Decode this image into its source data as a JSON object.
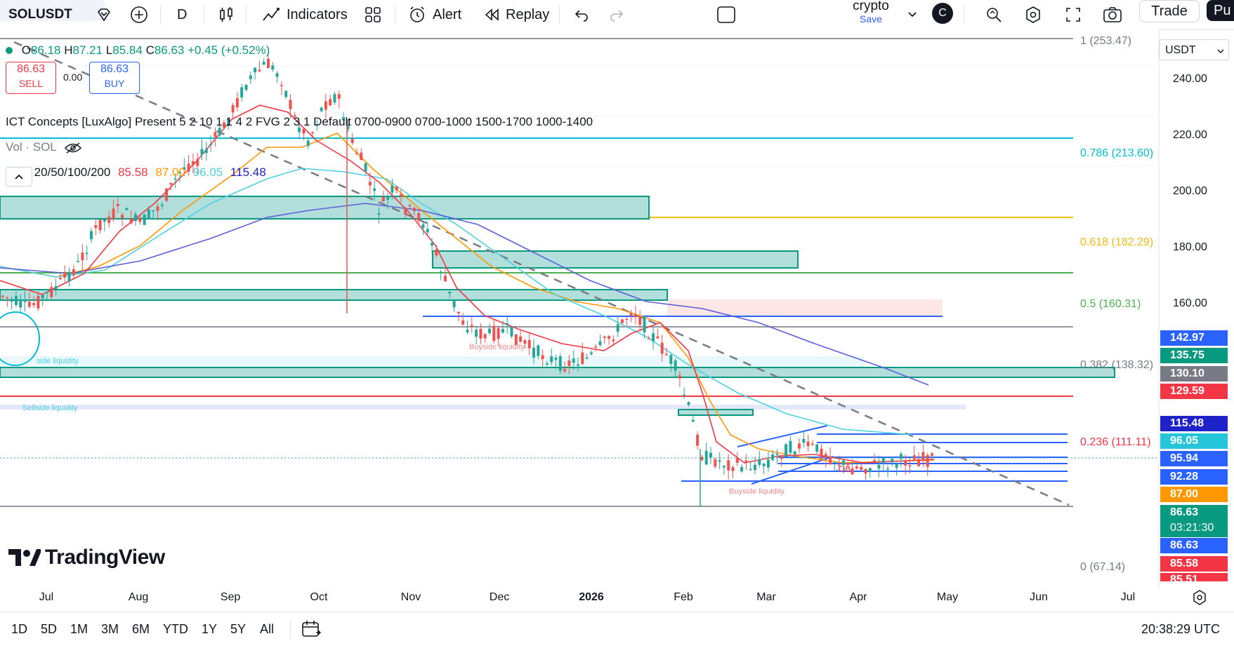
{
  "toolbar": {
    "symbol": "SOLUSDT",
    "interval": "D",
    "indicators_label": "Indicators",
    "alert_label": "Alert",
    "replay_label": "Replay",
    "layout_name": "crypto",
    "save_label": "Save",
    "avatar_letter": "C",
    "trade_label": "Trade",
    "publish_label": "Pu"
  },
  "legend": {
    "ohlc": {
      "o_label": "O",
      "o": "86.18",
      "h_label": "H",
      "h": "87.21",
      "l_label": "L",
      "l": "85.84",
      "c_label": "C",
      "c": "86.63",
      "change": "+0.45 (+0.52%)"
    },
    "sell_price": "86.63",
    "sell_label": "SELL",
    "spread": "0.00",
    "buy_price": "86.63",
    "buy_label": "BUY",
    "ict_indicator": "ICT Concepts [LuxAlgo] Present 5 2 10 1 1 4 2 FVG 2 3 1 Default 0700-0900 0700-1000 1500-1700 1000-1400",
    "volume_label": "Vol · SOL",
    "ema_label": "EMA 20/50/100/200",
    "ema_values": {
      "ema20": "85.58",
      "ema50": "87.00",
      "ema100": "96.05",
      "ema200": "115.48"
    }
  },
  "colors": {
    "up": "#26a69a",
    "down": "#ef5350",
    "ema20": "#f23645",
    "ema50": "#ff9800",
    "ema100": "#4dd0e1",
    "ema200": "#5c5fd6",
    "zone_fill": "#b2dfdb",
    "zone_border": "#089981",
    "blue_line": "#2962ff"
  },
  "price_scale": {
    "currency": "USDT",
    "ticks": [
      "240.00",
      "220.00",
      "200.00",
      "180.00",
      "160.00"
    ],
    "tags": [
      {
        "value": "142.97",
        "color": "#2962ff"
      },
      {
        "value": "135.75",
        "color": "#089981"
      },
      {
        "value": "130.10",
        "color": "#787b86"
      },
      {
        "value": "129.59",
        "color": "#f23645"
      },
      {
        "value": "115.48",
        "color": "#1e22c9"
      },
      {
        "value": "96.05",
        "color": "#26c6da"
      },
      {
        "value": "95.94",
        "color": "#2962ff"
      },
      {
        "value": "92.28",
        "color": "#2962ff"
      },
      {
        "value": "87.00",
        "color": "#ff9800"
      },
      {
        "value": "86.63",
        "color": "#089981"
      },
      {
        "value": "03:21:30",
        "color": "#089981"
      },
      {
        "value": "86.63",
        "color": "#2962ff"
      },
      {
        "value": "85.58",
        "color": "#f23645"
      },
      {
        "value": "85.51",
        "color": "#f23645"
      }
    ]
  },
  "fib": [
    {
      "label": "1 (253.47)",
      "color": "#787b86"
    },
    {
      "label": "0.786 (213.60)",
      "color": "#00bcd4"
    },
    {
      "label": "0.618 (182.29)",
      "color": "#f2b90f"
    },
    {
      "label": "0.5 (160.31)",
      "color": "#4caf50"
    },
    {
      "label": "0.382 (138.32)",
      "color": "#787b86"
    },
    {
      "label": "0.236 (111.11)",
      "color": "#f23645"
    },
    {
      "label": "0 (67.14)",
      "color": "#787b86"
    }
  ],
  "chart_annotations": {
    "buyside_1": "Buyside liquidity",
    "buyside_2": "Buyside liquidity",
    "sellside": "Sellside liquidity",
    "sellside_2": "side liquidity",
    "ob_label": "-OB"
  },
  "time_axis": [
    "Jul",
    "Aug",
    "Sep",
    "Oct",
    "Nov",
    "Dec",
    "2026",
    "Feb",
    "Mar",
    "Apr",
    "May",
    "Jun",
    "Jul"
  ],
  "logo_text": "TradingView",
  "bottom": {
    "ranges": [
      "1D",
      "5D",
      "1M",
      "3M",
      "6M",
      "YTD",
      "1Y",
      "5Y",
      "All"
    ],
    "utc_time": "20:38:29 UTC"
  }
}
